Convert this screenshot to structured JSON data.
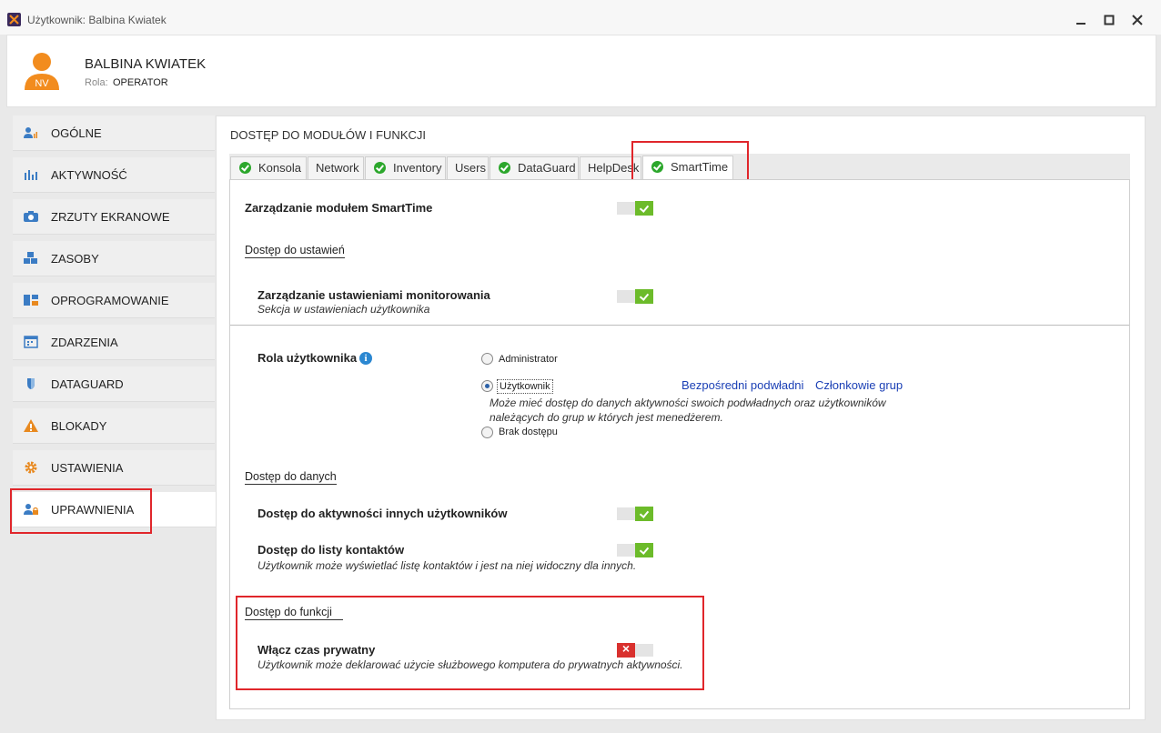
{
  "window": {
    "title": "Użytkownik: Balbina Kwiatek"
  },
  "user": {
    "initials": "NV",
    "name": "BALBINA KWIATEK",
    "role_label": "Rola:",
    "role_value": "OPERATOR"
  },
  "sidebar": {
    "items": [
      {
        "label": "OGÓLNE"
      },
      {
        "label": "AKTYWNOŚĆ"
      },
      {
        "label": "ZRZUTY EKRANOWE"
      },
      {
        "label": "ZASOBY"
      },
      {
        "label": "OPROGRAMOWANIE"
      },
      {
        "label": "ZDARZENIA"
      },
      {
        "label": "DATAGUARD"
      },
      {
        "label": "BLOKADY"
      },
      {
        "label": "USTAWIENIA"
      },
      {
        "label": "UPRAWNIENIA"
      }
    ]
  },
  "main": {
    "title": "DOSTĘP DO MODUŁÓW I FUNKCJI",
    "tabs": [
      {
        "label": "Konsola"
      },
      {
        "label": "Network"
      },
      {
        "label": "Inventory"
      },
      {
        "label": "Users"
      },
      {
        "label": "DataGuard"
      },
      {
        "label": "HelpDesk"
      },
      {
        "label": "SmartTime"
      }
    ],
    "module_mgmt": {
      "label": "Zarządzanie modułem SmartTime",
      "enabled": true
    },
    "settings_access": {
      "heading": "Dostęp do ustawień",
      "monitoring": {
        "label": "Zarządzanie ustawieniami monitorowania",
        "sub": "Sekcja w ustawieniach użytkownika",
        "enabled": true
      }
    },
    "role": {
      "label": "Rola użytkownika",
      "info": "i",
      "options": [
        {
          "label": "Administrator",
          "selected": false
        },
        {
          "label": "Użytkownik",
          "selected": true
        },
        {
          "label": "Brak dostępu",
          "selected": false
        }
      ],
      "user_desc_line1": "Może mieć dostęp do danych aktywności swoich podwładnych oraz użytkowników",
      "user_desc_line2": "należących do grup w których jest menedżerem.",
      "link_subordinates": "Bezpośredni podwładni",
      "link_groups": "Członkowie grup"
    },
    "data_access": {
      "heading": "Dostęp do danych",
      "activity": {
        "label": "Dostęp do aktywności innych użytkowników",
        "enabled": true
      },
      "contacts": {
        "label": "Dostęp do listy kontaktów",
        "sub": "Użytkownik może wyświetlać listę kontaktów i jest na niej widoczny dla innych.",
        "enabled": true
      }
    },
    "function_access": {
      "heading": "Dostęp do funkcji",
      "private_time": {
        "label": "Włącz czas prywatny",
        "sub": "Użytkownik może deklarować użycie służbowego komputera do prywatnych aktywności.",
        "enabled": false
      }
    }
  },
  "colors": {
    "accent_green": "#6cbb2a",
    "toggle_off_red": "#d9312e",
    "highlight_red": "#e0262b",
    "link_blue": "#1a3fb5",
    "avatar_orange": "#f28c1e"
  }
}
